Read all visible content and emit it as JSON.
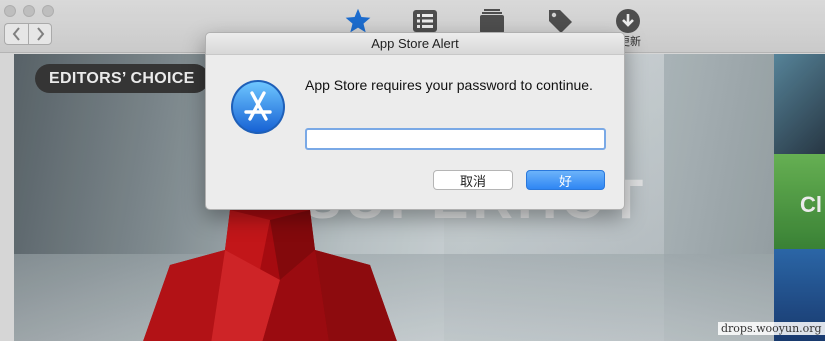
{
  "toolbar": {
    "back_icon": "chevron-left-icon",
    "forward_icon": "chevron-right-icon",
    "tools": [
      {
        "name": "featured",
        "icon": "star-icon"
      },
      {
        "name": "top-charts",
        "icon": "list-icon"
      },
      {
        "name": "categories",
        "icon": "stack-icon"
      },
      {
        "name": "purchased",
        "icon": "tag-icon"
      },
      {
        "name": "updates",
        "icon": "download-icon"
      }
    ],
    "updates_label": "更新"
  },
  "hero": {
    "badge": "EDITORS’ CHOICE",
    "title": "SUPERHOT",
    "side_text": "Cl"
  },
  "dialog": {
    "title": "App Store Alert",
    "message": "App Store requires your password to continue.",
    "password_value": "",
    "cancel_label": "取消",
    "ok_label": "好"
  },
  "watermark": "drops.wooyun.org",
  "colors": {
    "accent": "#2f86f3",
    "star": "#1f76e0"
  }
}
